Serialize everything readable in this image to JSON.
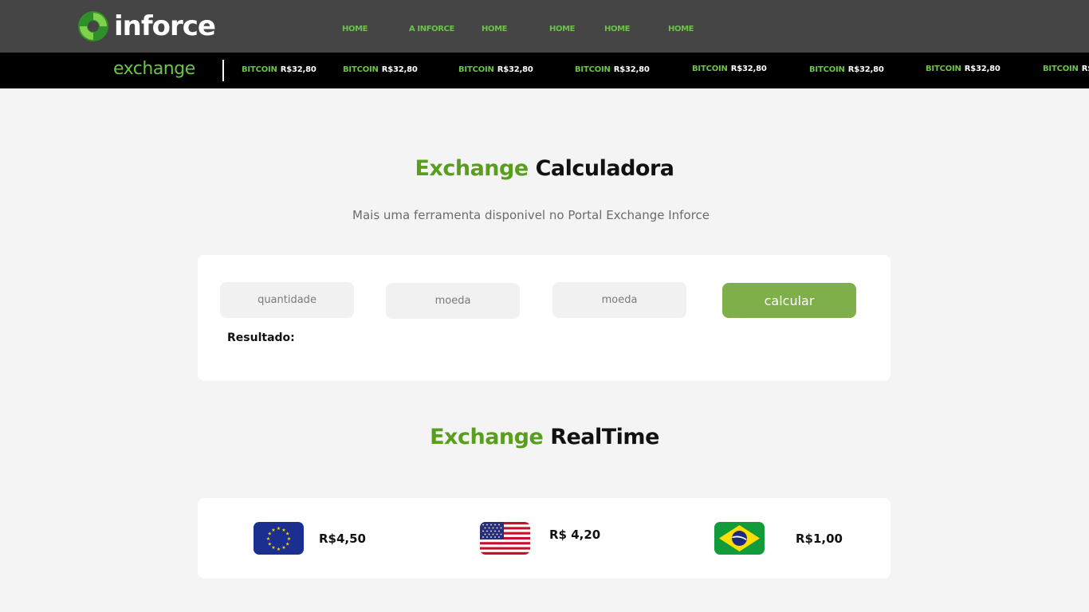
{
  "header": {
    "logo_text": "inforce",
    "nav": [
      "HOME",
      "A INFORCE",
      "HOME",
      "HOME",
      "HOME",
      "HOME"
    ]
  },
  "ticker": {
    "brand": "exchange",
    "items": [
      {
        "coin": "BITCOIN",
        "price": "R$32,80"
      },
      {
        "coin": "BITCOIN",
        "price": "R$32,80"
      },
      {
        "coin": "BITCOIN",
        "price": "R$32,80"
      },
      {
        "coin": "BITCOIN",
        "price": "R$32,80"
      },
      {
        "coin": "BITCOIN",
        "price": "R$32,80"
      },
      {
        "coin": "BITCOIN",
        "price": "R$32,80"
      },
      {
        "coin": "BITCOIN",
        "price": "R$32,80"
      },
      {
        "coin": "BITCOIN",
        "price": "R$"
      }
    ]
  },
  "calculator": {
    "title_accent": "Exchange",
    "title_rest": "Calculadora",
    "subtitle": "Mais uma ferramenta disponivel no Portal Exchange Inforce",
    "quantity_placeholder": "quantidade",
    "from_placeholder": "moeda",
    "to_placeholder": "moeda",
    "button_label": "calcular",
    "result_label": "Resultado:"
  },
  "realtime": {
    "title_accent": "Exchange",
    "title_rest": "RealTime",
    "rates": [
      {
        "flag": "eu-flag-icon",
        "value": "R$4,50"
      },
      {
        "flag": "us-flag-icon",
        "value": "R$ 4,20"
      },
      {
        "flag": "br-flag-icon",
        "value": "R$1,00"
      }
    ]
  },
  "colors": {
    "accent_green": "#5a9e1e",
    "nav_green": "#6cc24a",
    "button_green": "#7faf4a",
    "header_bg": "#454545",
    "ticker_bg": "#000000"
  }
}
